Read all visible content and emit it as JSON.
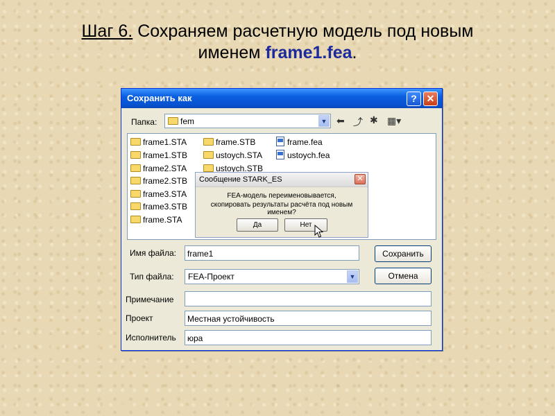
{
  "slide": {
    "step_label": "Шаг 6.",
    "title_rest": " Сохраняем расчетную модель под новым",
    "title_line2": "именем ",
    "filename": "frame1.fea",
    "title_dot": "."
  },
  "dialog": {
    "title": "Сохранить как",
    "help_label": "?",
    "close_label": "✕",
    "folder_label": "Папка:",
    "folder_value": "fem",
    "files_col1": [
      "frame1.STA",
      "frame1.STB",
      "frame2.STA",
      "frame2.STB",
      "frame3.STA",
      "frame3.STB",
      "frame.STA"
    ],
    "files_col2": [
      "frame.STB",
      "ustoych.STA",
      "ustoych.STB"
    ],
    "files_col3": [
      "frame.fea",
      "ustoych.fea"
    ],
    "filename_label": "Имя файла:",
    "filename_value": "frame1",
    "filetype_label": "Тип файла:",
    "filetype_value": "FEA-Проект",
    "note_label": "Примечание",
    "note_value": "",
    "project_label": "Проект",
    "project_value": "Местная устойчивость",
    "author_label": "Исполнитель",
    "author_value": "юра",
    "save_label": "Сохранить",
    "cancel_label": "Отмена"
  },
  "message": {
    "title": "Сообщение STARK_ES",
    "close_label": "✕",
    "line1": "FEA-модель переименовывается,",
    "line2": "скопировать результаты расчёта под новым именем?",
    "yes_label": "Да",
    "no_label": "Нет"
  },
  "colors": {
    "titlebar": "#0a5fe0",
    "filename_highlight": "#1c2a9c",
    "background": "#e8d9b4"
  }
}
